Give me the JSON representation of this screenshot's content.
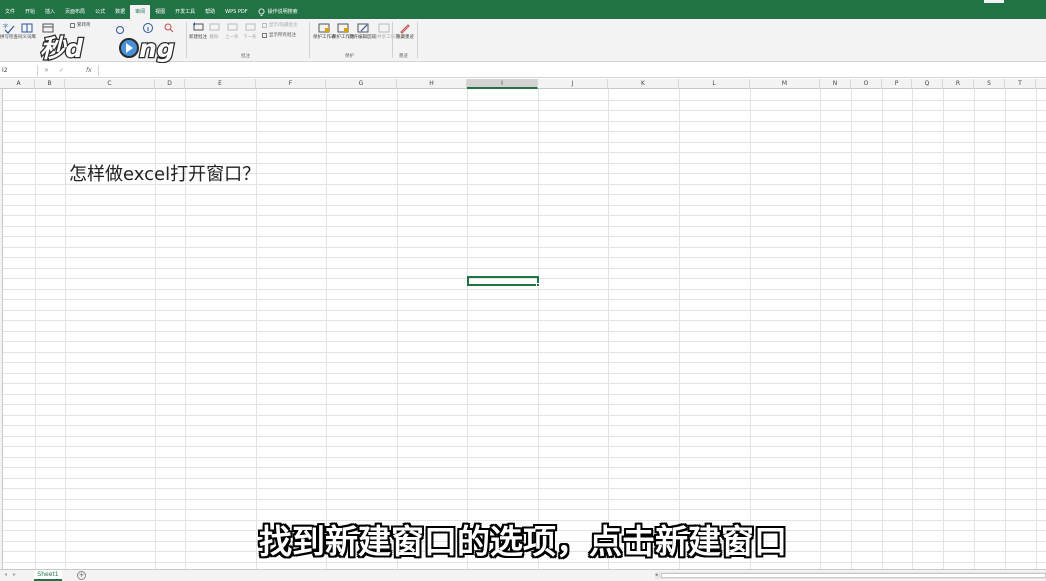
{
  "ribbon_tabs": [
    {
      "label": "文件",
      "active": false
    },
    {
      "label": "开始",
      "active": false
    },
    {
      "label": "插入",
      "active": false
    },
    {
      "label": "页面布局",
      "active": false
    },
    {
      "label": "公式",
      "active": false
    },
    {
      "label": "数据",
      "active": false
    },
    {
      "label": "审阅",
      "active": true
    },
    {
      "label": "视图",
      "active": false
    },
    {
      "label": "开发工具",
      "active": false
    },
    {
      "label": "帮助",
      "active": false
    },
    {
      "label": "WPS PDF",
      "active": false
    }
  ],
  "tell_me": "操作说明搜索",
  "ribbon": {
    "spell_check": "拼写检查",
    "thesaurus": "同义词库",
    "workbook_stats": "工作簿统计信息",
    "proofing_group": "校对",
    "trad_simp": "繁转简",
    "new_comment": "新建批注",
    "delete": "删除",
    "previous": "上一条",
    "next": "下一条",
    "show_hide_comment": "显示/隐藏批注",
    "show_all_comments": "显示所有批注",
    "comments_group": "批注",
    "protect_sheet": "保护工作表",
    "protect_workbook": "保护工作簿",
    "allow_edit_ranges": "允许编辑区域",
    "unshare_workbook": "取消共享工作簿",
    "protect_group": "保护",
    "hide_ink": "隐藏墨迹",
    "ink_group": "墨迹"
  },
  "formula_bar": {
    "name_box": "I2",
    "fx": "fx",
    "value": ""
  },
  "columns": [
    "A",
    "B",
    "C",
    "D",
    "E",
    "F",
    "G",
    "H",
    "I",
    "J",
    "K",
    "L",
    "M",
    "N",
    "O",
    "P",
    "Q",
    "R",
    "S",
    "T"
  ],
  "selected_column": "I",
  "cell_content": "怎样做excel打开窗口？",
  "caption": "找到新建窗口的选项，点击新建窗口",
  "sheet_tab": "Sheet1",
  "add_sheet": "+",
  "accent_color": "#217346"
}
